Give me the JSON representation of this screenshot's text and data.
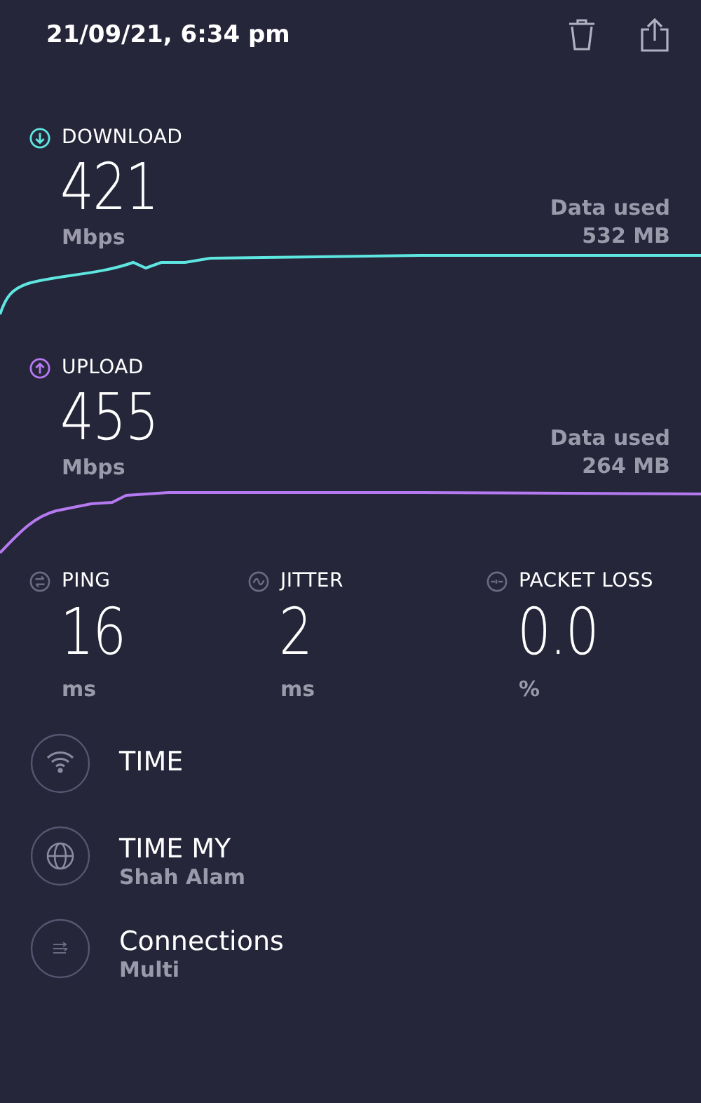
{
  "header": {
    "title": "21/09/21, 6:34 pm"
  },
  "speeds": [
    {
      "kind": "download",
      "label": "DOWNLOAD",
      "value": "421",
      "unit": "Mbps",
      "data_label": "Data used",
      "data_value": "532 MB",
      "color": "#5ee6e0"
    },
    {
      "kind": "upload",
      "label": "UPLOAD",
      "value": "455",
      "unit": "Mbps",
      "data_label": "Data used",
      "data_value": "264 MB",
      "color": "#b57af2"
    }
  ],
  "metrics": [
    {
      "kind": "ping",
      "label": "PING",
      "value": "16",
      "unit": "ms"
    },
    {
      "kind": "jitter",
      "label": "JITTER",
      "value": "2",
      "unit": "ms"
    },
    {
      "kind": "packet_loss",
      "label": "PACKET LOSS",
      "value": "0.0",
      "unit": "%"
    }
  ],
  "details": [
    {
      "kind": "wifi",
      "title": "TIME"
    },
    {
      "kind": "globe",
      "title": "TIME MY",
      "subtitle": "Shah Alam"
    },
    {
      "kind": "connections",
      "title": "Connections",
      "subtitle": "Multi"
    }
  ]
}
